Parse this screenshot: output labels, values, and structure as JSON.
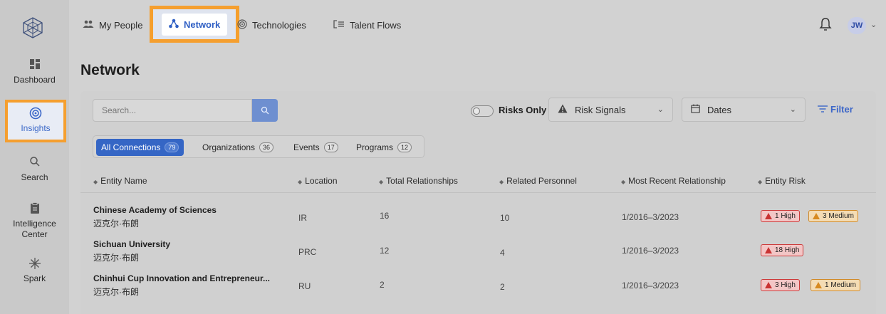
{
  "topnav": {
    "tabs": [
      {
        "label": "My People",
        "icon": "people-icon"
      },
      {
        "label": "Network",
        "icon": "network-icon"
      },
      {
        "label": "Technologies",
        "icon": "technologies-icon"
      },
      {
        "label": "Talent Flows",
        "icon": "talent-flows-icon"
      }
    ],
    "user_initials": "JW"
  },
  "sidebar": {
    "items": [
      {
        "label": "Dashboard",
        "icon": "dashboard-icon"
      },
      {
        "label": "Insights",
        "icon": "target-icon"
      },
      {
        "label": "Search",
        "icon": "search-icon"
      },
      {
        "label": "Intelligence Center",
        "icon": "clipboard-icon"
      },
      {
        "label": "Spark",
        "icon": "spark-icon"
      }
    ]
  },
  "page": {
    "title": "Network"
  },
  "filters": {
    "search_placeholder": "Search...",
    "risks_only_label": "Risks Only",
    "risk_signals_label": "Risk Signals",
    "dates_label": "Dates",
    "filter_label": "Filter"
  },
  "segments": [
    {
      "label": "All Connections",
      "count": "79"
    },
    {
      "label": "Organizations",
      "count": "36"
    },
    {
      "label": "Events",
      "count": "17"
    },
    {
      "label": "Programs",
      "count": "12"
    }
  ],
  "table": {
    "columns": [
      "Entity Name",
      "Location",
      "Total Relationships",
      "Related Personnel",
      "Most Recent Relationship",
      "Entity Risk"
    ],
    "rows": [
      {
        "name": "Chinese Academy of Sciences",
        "sub": "迈克尔·布朗",
        "location": "IR",
        "total": "16",
        "personnel": "10",
        "recent": "1/2016–3/2023",
        "risk_high": "1 High",
        "risk_med": "3 Medium"
      },
      {
        "name": "Sichuan University",
        "sub": "迈克尔·布朗",
        "location": "PRC",
        "total": "12",
        "personnel": "4",
        "recent": "1/2016–3/2023",
        "risk_high": "18 High",
        "risk_med": ""
      },
      {
        "name": "Chinhui Cup Innovation and Entrepreneur...",
        "sub": "迈克尔·布朗",
        "location": "RU",
        "total": "2",
        "personnel": "2",
        "recent": "1/2016–3/2023",
        "risk_high": "3 High",
        "risk_med": "1 Medium"
      }
    ]
  },
  "colors": {
    "accent": "#3566c5",
    "highlight": "#f59f2f",
    "risk_high": "#c93232",
    "risk_medium": "#d78a20"
  }
}
